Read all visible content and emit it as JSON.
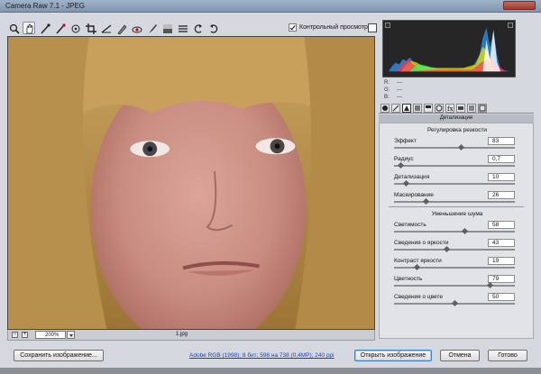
{
  "window": {
    "title": "Camera Raw 7.1 - JPEG"
  },
  "toolbar": {
    "tools": [
      "zoom-icon",
      "hand-icon",
      "white-balance-icon",
      "color-sampler-icon",
      "target-adjust-icon",
      "crop-icon",
      "straighten-icon",
      "spot-removal-icon",
      "red-eye-icon",
      "adjustment-brush-icon",
      "graduated-filter-icon",
      "preferences-icon",
      "rotate-ccw-icon",
      "rotate-cw-icon"
    ],
    "preview_label": "Контрольный просмотр",
    "preview_checked": true
  },
  "preview": {
    "zoom": "200%",
    "filename": "1.jpg"
  },
  "readout": {
    "r_label": "R:",
    "r_value": "---",
    "g_label": "G:",
    "g_value": "---",
    "b_label": "B:",
    "b_value": "---"
  },
  "panel": {
    "title": "Детализация",
    "sharpening": {
      "title": "Регулировка резкости",
      "sliders": [
        {
          "label": "Эффект",
          "value": "83",
          "level": 0.55
        },
        {
          "label": "Радиус",
          "value": "0,7",
          "level": 0.05
        },
        {
          "label": "Детализация",
          "value": "10",
          "level": 0.1
        },
        {
          "label": "Маскирование",
          "value": "26",
          "level": 0.26
        }
      ]
    },
    "noise": {
      "title": "Уменьшение шума",
      "sliders": [
        {
          "label": "Светимость",
          "value": "58",
          "level": 0.58
        },
        {
          "label": "Сведения о яркости",
          "value": "43",
          "level": 0.43
        },
        {
          "label": "Контраст яркости",
          "value": "19",
          "level": 0.19
        },
        {
          "label": "Цветность",
          "value": "79",
          "level": 0.79
        },
        {
          "label": "Сведения о цвете",
          "value": "50",
          "level": 0.5
        }
      ]
    }
  },
  "footer": {
    "save_label": "Сохранить изображение...",
    "workflow_link": "Adobe RGB (1998); 8 бит; 596 на 738 (0,4МР); 240 ppi",
    "open_label": "Открыть изображение",
    "cancel_label": "Отмена",
    "done_label": "Готово"
  },
  "colors": {
    "accent": "#3a7fc0",
    "link": "#1a3fbd"
  }
}
